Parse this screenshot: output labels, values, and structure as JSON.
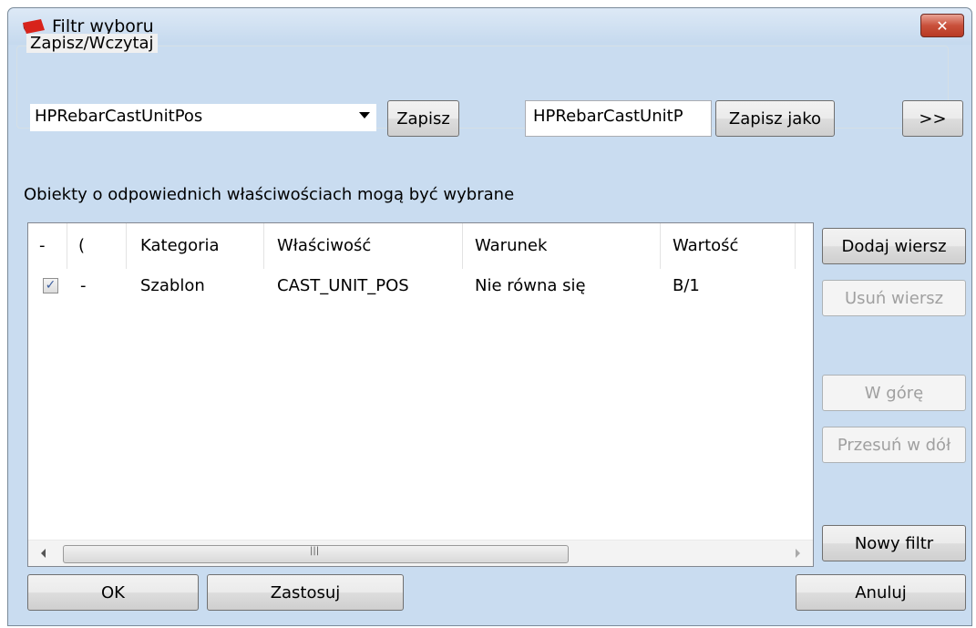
{
  "window": {
    "title": "Filtr wyboru",
    "close_label": "✕"
  },
  "save_load": {
    "group_label": "Zapisz/Wczytaj",
    "combo_value": "HPRebarCastUnitPos",
    "save_label": "Zapisz",
    "name_input_value": "HPRebarCastUnitP",
    "save_as_label": "Zapisz jako",
    "more_label": ">>"
  },
  "info_text": "Obiekty o odpowiednich właściwościach mogą być wybrane",
  "table": {
    "columns": [
      "-",
      "(",
      "Kategoria",
      "Właściwość",
      "Warunek",
      "Wartość"
    ],
    "rows": [
      {
        "checked": true,
        "paren": "-",
        "category": "Szablon",
        "property": "CAST_UNIT_POS",
        "condition": "Nie równa się",
        "value": "B/1"
      }
    ]
  },
  "side_buttons": {
    "add_row": "Dodaj wiersz",
    "remove_row": "Usuń wiersz",
    "move_up": "W górę",
    "move_down": "Przesuń w dół",
    "new_filter": "Nowy filtr"
  },
  "footer": {
    "ok": "OK",
    "apply": "Zastosuj",
    "cancel": "Anuluj"
  }
}
